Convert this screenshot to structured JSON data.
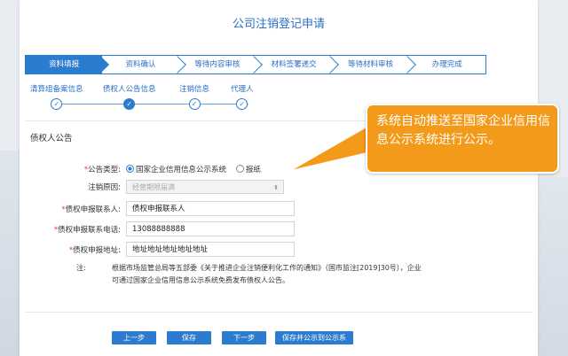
{
  "page": {
    "title": "公司注销登记申请"
  },
  "steps": [
    {
      "label": "资料填报",
      "active": true
    },
    {
      "label": "资料确认",
      "active": false
    },
    {
      "label": "等待内容审核",
      "active": false
    },
    {
      "label": "材料签署递交",
      "active": false
    },
    {
      "label": "等待材料审核",
      "active": false
    },
    {
      "label": "办理完成",
      "active": false
    }
  ],
  "substeps": [
    {
      "label": "清算组备案信息",
      "mark": "✓"
    },
    {
      "label": "债权人公告信息",
      "mark": "✓"
    },
    {
      "label": "注销信息",
      "mark": "✓"
    },
    {
      "label": "代理人",
      "mark": "✓"
    }
  ],
  "section": {
    "title": "债权人公告"
  },
  "form": {
    "announce_type": {
      "label": "公告类型:",
      "options": [
        "国家企业信用信息公示系统",
        "报纸"
      ]
    },
    "reason": {
      "label": "注销原因:",
      "placeholder": "经营期限届满"
    },
    "contact": {
      "label": "债权申报联系人:",
      "value": "债权申报联系人"
    },
    "phone": {
      "label": "债权申报联系电话:",
      "value": "13088888888"
    },
    "address": {
      "label": "债权申报地址:",
      "value": "地址地址地址地址地址"
    }
  },
  "note": {
    "tag": "注:",
    "text": "根据市场监管总局等五部委《关于推进企业注销便利化工作的通知》（国市监注[2019]30号），企业可通过国家企业信用信息公示系统免费发布债权人公告。"
  },
  "buttons": {
    "prev": "上一步",
    "save": "保存",
    "next": "下一步",
    "save_publish": "保存并公示到公示系"
  },
  "callout": {
    "text": "系统自动推送至国家企业信用信息公示系统进行公示。"
  },
  "colors": {
    "primary": "#2b7bcf",
    "accent": "#f39a1a",
    "required": "#e03a3a"
  }
}
